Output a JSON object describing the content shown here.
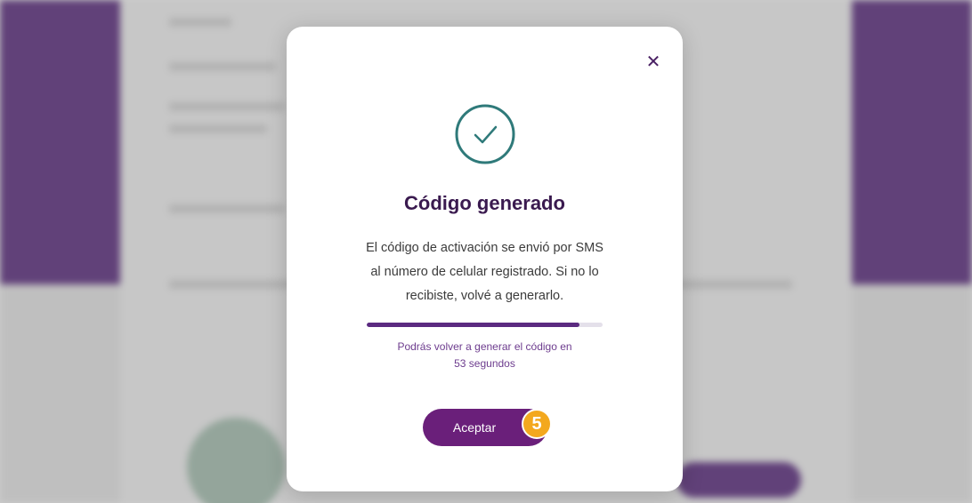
{
  "modal": {
    "close_icon": "close-icon",
    "status_icon": "check-circle-icon",
    "title": "Código generado",
    "body_lines": [
      "El código de activación se envió por SMS",
      "al número de celular registrado. Si no lo",
      "recibiste, volvé a generarlo."
    ],
    "progress_fraction": 0.9,
    "timer_line1": "Podrás volver a generar el código en",
    "timer_line2": "53 segundos",
    "accept_label": "Aceptar",
    "step_badge": "5"
  },
  "colors": {
    "primary": "#6a1f7a",
    "title": "#3a1a4f",
    "check": "#2f7a7a",
    "badge": "#f3a81e"
  }
}
